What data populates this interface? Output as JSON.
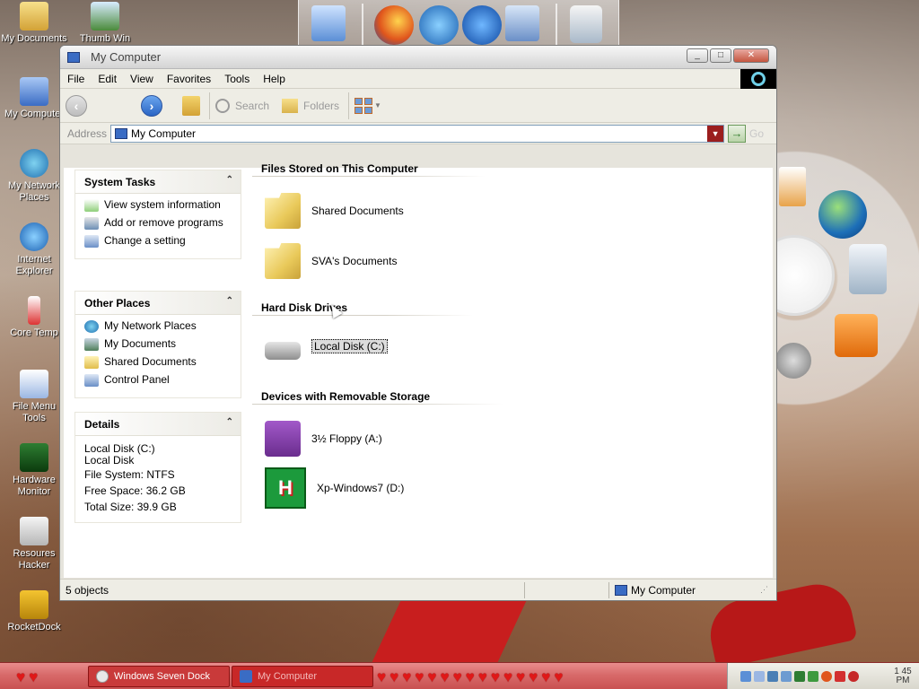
{
  "desktop": {
    "icons": [
      {
        "label": "My Documents"
      },
      {
        "label": "My Computer"
      },
      {
        "label": "My Network Places"
      },
      {
        "label": "Internet Explorer"
      },
      {
        "label": "Core Temp"
      },
      {
        "label": "File Menu Tools"
      },
      {
        "label": "Hardware Monitor"
      },
      {
        "label": "Resoures Hacker"
      },
      {
        "label": "RocketDock"
      },
      {
        "label": "Thumb Win"
      }
    ]
  },
  "window": {
    "title": "My Computer",
    "buttons": {
      "minimize": "_",
      "maximize": "□",
      "close": "✕"
    }
  },
  "menu": [
    "File",
    "Edit",
    "View",
    "Favorites",
    "Tools",
    "Help"
  ],
  "toolbar": {
    "back": "‹",
    "forward": "›",
    "search": "Search",
    "folders": "Folders"
  },
  "address": {
    "label": "Address",
    "value": "My Computer",
    "go": "Go"
  },
  "sidebar": {
    "system_tasks": {
      "title": "System Tasks",
      "items": [
        "View system information",
        "Add or remove programs",
        "Change a setting"
      ]
    },
    "other_places": {
      "title": "Other Places",
      "items": [
        "My Network Places",
        "My Documents",
        "Shared Documents",
        "Control Panel"
      ]
    },
    "details": {
      "title": "Details",
      "lines": [
        "Local Disk (C:)",
        "Local Disk",
        "File System: NTFS",
        "Free Space: 36.2 GB",
        "Total Size: 39.9 GB"
      ]
    }
  },
  "groups": {
    "stored": {
      "title": "Files Stored on This Computer",
      "items": [
        "Shared Documents",
        "SVA's Documents"
      ]
    },
    "hdd": {
      "title": "Hard Disk Drives",
      "items": [
        "Local Disk (C:)"
      ]
    },
    "removable": {
      "title": "Devices with Removable Storage",
      "items": [
        "3½ Floppy (A:)",
        "Xp-Windows7 (D:)"
      ]
    }
  },
  "statusbar": {
    "objects": "5 objects",
    "location": "My Computer"
  },
  "taskbar": {
    "tasks": [
      "Windows Seven Dock",
      "My Computer"
    ],
    "clock": "1 45 PM"
  },
  "colors": {
    "accent": "#3a6cc4",
    "taskbar": "#d86a6a",
    "titlebar": "#d4d4d4"
  }
}
